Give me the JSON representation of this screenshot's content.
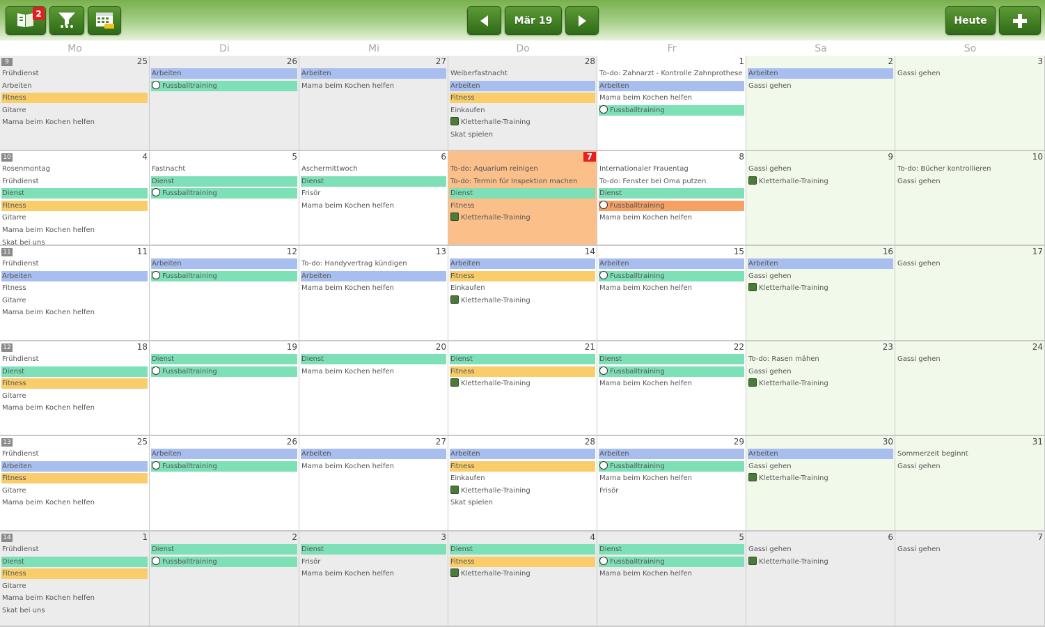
{
  "toolbar": {
    "notification_badge": "2",
    "month_label": "Mär 19",
    "today_label": "Heute"
  },
  "weekdays": [
    "Mo",
    "Di",
    "Mi",
    "Do",
    "Fr",
    "Sa",
    "So"
  ],
  "event_colors": {
    "blue": "#a8beef",
    "green": "#7ee0b6",
    "yellow": "#f9cd6a",
    "orange": "#f6a064"
  },
  "weeks": [
    {
      "week_number": "9",
      "days": [
        {
          "num": "25",
          "kind": "other",
          "events": [
            {
              "text": "Frühdienst",
              "c": ""
            },
            {
              "text": "Arbeiten",
              "c": ""
            },
            {
              "text": "Fitness",
              "c": "yellow"
            },
            {
              "text": "Gitarre",
              "c": ""
            },
            {
              "text": "Mama beim Kochen helfen",
              "c": ""
            }
          ]
        },
        {
          "num": "26",
          "kind": "other",
          "events": [
            {
              "text": "Arbeiten",
              "c": "blue"
            },
            {
              "text": "Fussballtraining",
              "c": "green",
              "icon": "soccer-ball-icon"
            }
          ]
        },
        {
          "num": "27",
          "kind": "other",
          "events": [
            {
              "text": "Arbeiten",
              "c": "blue"
            },
            {
              "text": "Mama beim Kochen helfen",
              "c": ""
            }
          ]
        },
        {
          "num": "28",
          "kind": "other",
          "events": [
            {
              "text": "Weiberfastnacht",
              "c": ""
            },
            {
              "text": "Arbeiten",
              "c": "blue"
            },
            {
              "text": "Fitness",
              "c": "yellow"
            },
            {
              "text": "Einkaufen",
              "c": ""
            },
            {
              "text": "Kletterhalle-Training",
              "c": "",
              "icon": "climbing-icon"
            },
            {
              "text": "Skat spielen",
              "c": ""
            }
          ]
        },
        {
          "num": "1",
          "kind": "curr",
          "events": [
            {
              "text": "To-do: Zahnarzt - Kontrolle Zahnprothese",
              "c": ""
            },
            {
              "text": "Arbeiten",
              "c": "blue"
            },
            {
              "text": "Mama beim Kochen helfen",
              "c": ""
            },
            {
              "text": "Fussballtraining",
              "c": "green",
              "icon": "soccer-ball-icon"
            }
          ]
        },
        {
          "num": "2",
          "kind": "weekend",
          "events": [
            {
              "text": "Arbeiten",
              "c": "blue"
            },
            {
              "text": "Gassi gehen",
              "c": ""
            }
          ]
        },
        {
          "num": "3",
          "kind": "weekend",
          "events": [
            {
              "text": "Gassi gehen",
              "c": ""
            }
          ]
        }
      ]
    },
    {
      "week_number": "10",
      "days": [
        {
          "num": "4",
          "kind": "curr",
          "events": [
            {
              "text": "Rosenmontag",
              "c": ""
            },
            {
              "text": "Frühdienst",
              "c": ""
            },
            {
              "text": "Dienst",
              "c": "green"
            },
            {
              "text": "Fitness",
              "c": "yellow"
            },
            {
              "text": "Gitarre",
              "c": ""
            },
            {
              "text": "Mama beim Kochen helfen",
              "c": ""
            },
            {
              "text": "Skat bei uns",
              "c": ""
            }
          ]
        },
        {
          "num": "5",
          "kind": "curr",
          "events": [
            {
              "text": "Fastnacht",
              "c": ""
            },
            {
              "text": "Dienst",
              "c": "green"
            },
            {
              "text": "Fussballtraining",
              "c": "green",
              "icon": "soccer-ball-icon"
            }
          ]
        },
        {
          "num": "6",
          "kind": "curr",
          "events": [
            {
              "text": "Aschermittwoch",
              "c": ""
            },
            {
              "text": "Dienst",
              "c": "green"
            },
            {
              "text": "Frisör",
              "c": ""
            },
            {
              "text": "Mama beim Kochen helfen",
              "c": ""
            }
          ]
        },
        {
          "num": "7",
          "kind": "today",
          "events": [
            {
              "text": "To-do: Aquarium reinigen",
              "c": ""
            },
            {
              "text": "To-do: Termin für Inspektion machen",
              "c": ""
            },
            {
              "text": "Dienst",
              "c": "green"
            },
            {
              "text": "Fitness",
              "c": ""
            },
            {
              "text": "Kletterhalle-Training",
              "c": "",
              "icon": "climbing-icon"
            }
          ]
        },
        {
          "num": "8",
          "kind": "curr",
          "events": [
            {
              "text": "Internationaler Frauentag",
              "c": ""
            },
            {
              "text": "To-do: Fenster bei Oma putzen",
              "c": ""
            },
            {
              "text": "Dienst",
              "c": "green"
            },
            {
              "text": "Fussballtraining",
              "c": "orange",
              "icon": "soccer-ball-icon"
            },
            {
              "text": "Mama beim Kochen helfen",
              "c": ""
            }
          ]
        },
        {
          "num": "9",
          "kind": "weekend",
          "events": [
            {
              "text": "Gassi gehen",
              "c": ""
            },
            {
              "text": "Kletterhalle-Training",
              "c": "",
              "icon": "climbing-icon"
            }
          ]
        },
        {
          "num": "10",
          "kind": "weekend",
          "events": [
            {
              "text": "To-do: Bücher kontrollieren",
              "c": ""
            },
            {
              "text": "Gassi gehen",
              "c": ""
            }
          ]
        }
      ]
    },
    {
      "week_number": "11",
      "days": [
        {
          "num": "11",
          "kind": "curr",
          "events": [
            {
              "text": "Frühdienst",
              "c": ""
            },
            {
              "text": "Arbeiten",
              "c": "blue"
            },
            {
              "text": "Fitness",
              "c": ""
            },
            {
              "text": "Gitarre",
              "c": ""
            },
            {
              "text": "Mama beim Kochen helfen",
              "c": ""
            }
          ]
        },
        {
          "num": "12",
          "kind": "curr",
          "events": [
            {
              "text": "Arbeiten",
              "c": "blue"
            },
            {
              "text": "Fussballtraining",
              "c": "green",
              "icon": "soccer-ball-icon"
            }
          ]
        },
        {
          "num": "13",
          "kind": "curr",
          "events": [
            {
              "text": "To-do: Handyvertrag kündigen",
              "c": ""
            },
            {
              "text": "Arbeiten",
              "c": "blue"
            },
            {
              "text": "Mama beim Kochen helfen",
              "c": ""
            }
          ]
        },
        {
          "num": "14",
          "kind": "curr",
          "events": [
            {
              "text": "Arbeiten",
              "c": "blue"
            },
            {
              "text": "Fitness",
              "c": "yellow"
            },
            {
              "text": "Einkaufen",
              "c": ""
            },
            {
              "text": "Kletterhalle-Training",
              "c": "",
              "icon": "climbing-icon"
            }
          ]
        },
        {
          "num": "15",
          "kind": "curr",
          "events": [
            {
              "text": "Arbeiten",
              "c": "blue"
            },
            {
              "text": "Fussballtraining",
              "c": "green",
              "icon": "soccer-ball-icon"
            },
            {
              "text": "Mama beim Kochen helfen",
              "c": ""
            }
          ]
        },
        {
          "num": "16",
          "kind": "weekend",
          "events": [
            {
              "text": "Arbeiten",
              "c": "blue"
            },
            {
              "text": "Gassi gehen",
              "c": ""
            },
            {
              "text": "Kletterhalle-Training",
              "c": "",
              "icon": "climbing-icon"
            }
          ]
        },
        {
          "num": "17",
          "kind": "weekend",
          "events": [
            {
              "text": "Gassi gehen",
              "c": ""
            }
          ]
        }
      ]
    },
    {
      "week_number": "12",
      "days": [
        {
          "num": "18",
          "kind": "curr",
          "events": [
            {
              "text": "Frühdienst",
              "c": ""
            },
            {
              "text": "Dienst",
              "c": "green"
            },
            {
              "text": "Fitness",
              "c": "yellow"
            },
            {
              "text": "Gitarre",
              "c": ""
            },
            {
              "text": "Mama beim Kochen helfen",
              "c": ""
            }
          ]
        },
        {
          "num": "19",
          "kind": "curr",
          "events": [
            {
              "text": "Dienst",
              "c": "green"
            },
            {
              "text": "Fussballtraining",
              "c": "green",
              "icon": "soccer-ball-icon"
            }
          ]
        },
        {
          "num": "20",
          "kind": "curr",
          "events": [
            {
              "text": "Dienst",
              "c": "green"
            },
            {
              "text": "Mama beim Kochen helfen",
              "c": ""
            }
          ]
        },
        {
          "num": "21",
          "kind": "curr",
          "events": [
            {
              "text": "Dienst",
              "c": "green"
            },
            {
              "text": "Fitness",
              "c": "yellow"
            },
            {
              "text": "Kletterhalle-Training",
              "c": "",
              "icon": "climbing-icon"
            }
          ]
        },
        {
          "num": "22",
          "kind": "curr",
          "events": [
            {
              "text": "Dienst",
              "c": "green"
            },
            {
              "text": "Fussballtraining",
              "c": "green",
              "icon": "soccer-ball-icon"
            },
            {
              "text": "Mama beim Kochen helfen",
              "c": ""
            }
          ]
        },
        {
          "num": "23",
          "kind": "weekend",
          "events": [
            {
              "text": "To-do: Rasen mähen",
              "c": ""
            },
            {
              "text": "Gassi gehen",
              "c": ""
            },
            {
              "text": "Kletterhalle-Training",
              "c": "",
              "icon": "climbing-icon"
            }
          ]
        },
        {
          "num": "24",
          "kind": "weekend",
          "events": [
            {
              "text": "Gassi gehen",
              "c": ""
            }
          ]
        }
      ]
    },
    {
      "week_number": "13",
      "days": [
        {
          "num": "25",
          "kind": "curr",
          "events": [
            {
              "text": "Frühdienst",
              "c": ""
            },
            {
              "text": "Arbeiten",
              "c": "blue"
            },
            {
              "text": "Fitness",
              "c": "yellow"
            },
            {
              "text": "Gitarre",
              "c": ""
            },
            {
              "text": "Mama beim Kochen helfen",
              "c": ""
            }
          ]
        },
        {
          "num": "26",
          "kind": "curr",
          "events": [
            {
              "text": "Arbeiten",
              "c": "blue"
            },
            {
              "text": "Fussballtraining",
              "c": "green",
              "icon": "soccer-ball-icon"
            }
          ]
        },
        {
          "num": "27",
          "kind": "curr",
          "events": [
            {
              "text": "Arbeiten",
              "c": "blue"
            },
            {
              "text": "Mama beim Kochen helfen",
              "c": ""
            }
          ]
        },
        {
          "num": "28",
          "kind": "curr",
          "events": [
            {
              "text": "Arbeiten",
              "c": "blue"
            },
            {
              "text": "Fitness",
              "c": "yellow"
            },
            {
              "text": "Einkaufen",
              "c": ""
            },
            {
              "text": "Kletterhalle-Training",
              "c": "",
              "icon": "climbing-icon"
            },
            {
              "text": "Skat spielen",
              "c": ""
            }
          ]
        },
        {
          "num": "29",
          "kind": "curr",
          "events": [
            {
              "text": "Arbeiten",
              "c": "blue"
            },
            {
              "text": "Fussballtraining",
              "c": "green",
              "icon": "soccer-ball-icon"
            },
            {
              "text": "Mama beim Kochen helfen",
              "c": ""
            },
            {
              "text": "Frisör",
              "c": ""
            }
          ]
        },
        {
          "num": "30",
          "kind": "weekend",
          "events": [
            {
              "text": "Arbeiten",
              "c": "blue"
            },
            {
              "text": "Gassi gehen",
              "c": ""
            },
            {
              "text": "Kletterhalle-Training",
              "c": "",
              "icon": "climbing-icon"
            }
          ]
        },
        {
          "num": "31",
          "kind": "weekend",
          "events": [
            {
              "text": "Sommerzeit beginnt",
              "c": ""
            },
            {
              "text": "Gassi gehen",
              "c": ""
            }
          ]
        }
      ]
    },
    {
      "week_number": "14",
      "days": [
        {
          "num": "1",
          "kind": "other",
          "events": [
            {
              "text": "Frühdienst",
              "c": ""
            },
            {
              "text": "Dienst",
              "c": "green"
            },
            {
              "text": "Fitness",
              "c": "yellow"
            },
            {
              "text": "Gitarre",
              "c": ""
            },
            {
              "text": "Mama beim Kochen helfen",
              "c": ""
            },
            {
              "text": "Skat bei uns",
              "c": ""
            }
          ]
        },
        {
          "num": "2",
          "kind": "other",
          "events": [
            {
              "text": "Dienst",
              "c": "green"
            },
            {
              "text": "Fussballtraining",
              "c": "green",
              "icon": "soccer-ball-icon"
            }
          ]
        },
        {
          "num": "3",
          "kind": "other",
          "events": [
            {
              "text": "Dienst",
              "c": "green"
            },
            {
              "text": "Frisör",
              "c": ""
            },
            {
              "text": "Mama beim Kochen helfen",
              "c": ""
            }
          ]
        },
        {
          "num": "4",
          "kind": "other",
          "events": [
            {
              "text": "Dienst",
              "c": "green"
            },
            {
              "text": "Fitness",
              "c": "yellow"
            },
            {
              "text": "Kletterhalle-Training",
              "c": "",
              "icon": "climbing-icon"
            }
          ]
        },
        {
          "num": "5",
          "kind": "other",
          "events": [
            {
              "text": "Dienst",
              "c": "green"
            },
            {
              "text": "Fussballtraining",
              "c": "green",
              "icon": "soccer-ball-icon"
            },
            {
              "text": "Mama beim Kochen helfen",
              "c": ""
            }
          ]
        },
        {
          "num": "6",
          "kind": "other",
          "events": [
            {
              "text": "Gassi gehen",
              "c": ""
            },
            {
              "text": "Kletterhalle-Training",
              "c": "",
              "icon": "climbing-icon"
            }
          ]
        },
        {
          "num": "7",
          "kind": "other",
          "events": [
            {
              "text": "Gassi gehen",
              "c": ""
            }
          ]
        }
      ]
    }
  ]
}
